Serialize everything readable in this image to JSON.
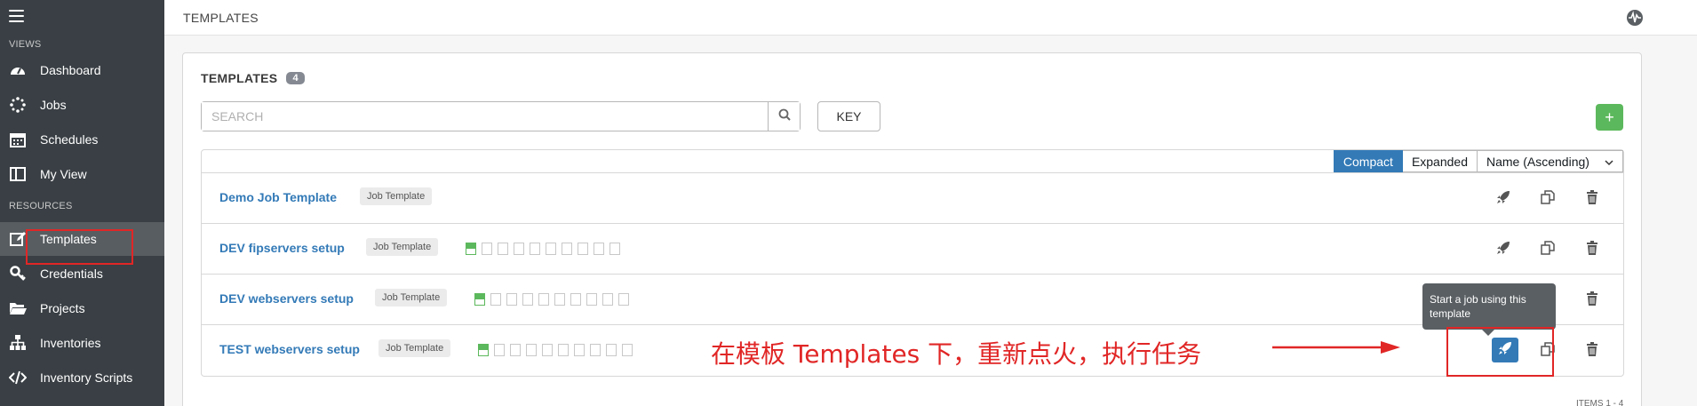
{
  "sidebar": {
    "views_label": "VIEWS",
    "resources_label": "RESOURCES",
    "views": [
      {
        "label": "Dashboard",
        "icon": "dashboard-icon"
      },
      {
        "label": "Jobs",
        "icon": "jobs-icon"
      },
      {
        "label": "Schedules",
        "icon": "calendar-icon"
      },
      {
        "label": "My View",
        "icon": "my-view-icon"
      }
    ],
    "resources": [
      {
        "label": "Templates",
        "icon": "edit-icon",
        "active": true
      },
      {
        "label": "Credentials",
        "icon": "key-icon"
      },
      {
        "label": "Projects",
        "icon": "folder-icon"
      },
      {
        "label": "Inventories",
        "icon": "sitemap-icon"
      },
      {
        "label": "Inventory Scripts",
        "icon": "code-icon"
      }
    ]
  },
  "header": {
    "title": "TEMPLATES",
    "activity_icon": "activity-stream-icon"
  },
  "panel": {
    "title": "TEMPLATES",
    "count": "4",
    "search_placeholder": "SEARCH",
    "key_label": "KEY",
    "add_label": "+",
    "view_compact": "Compact",
    "view_expanded": "Expanded",
    "sort_label": "Name (Ascending)",
    "items_footer": "ITEMS 1 - 4"
  },
  "templates": [
    {
      "name": "Demo Job Template",
      "type": "Job Template",
      "jobs": []
    },
    {
      "name": "DEV fipservers setup",
      "type": "Job Template",
      "jobs": [
        "ok",
        "none",
        "none",
        "none",
        "none",
        "none",
        "none",
        "none",
        "none",
        "none"
      ]
    },
    {
      "name": "DEV webservers setup",
      "type": "Job Template",
      "jobs": [
        "ok",
        "none",
        "none",
        "none",
        "none",
        "none",
        "none",
        "none",
        "none",
        "none"
      ]
    },
    {
      "name": "TEST webservers setup",
      "type": "Job Template",
      "jobs": [
        "ok",
        "none",
        "none",
        "none",
        "none",
        "none",
        "none",
        "none",
        "none",
        "none"
      ]
    }
  ],
  "tooltip": {
    "text": "Start a job using this template"
  },
  "annotation": {
    "text": "在模板 Templates 下，重新点火，执行任务",
    "color": "#e12626"
  },
  "colors": {
    "sidebar_bg": "#393f44",
    "accent": "#337ab7",
    "success": "#5cb85c"
  }
}
